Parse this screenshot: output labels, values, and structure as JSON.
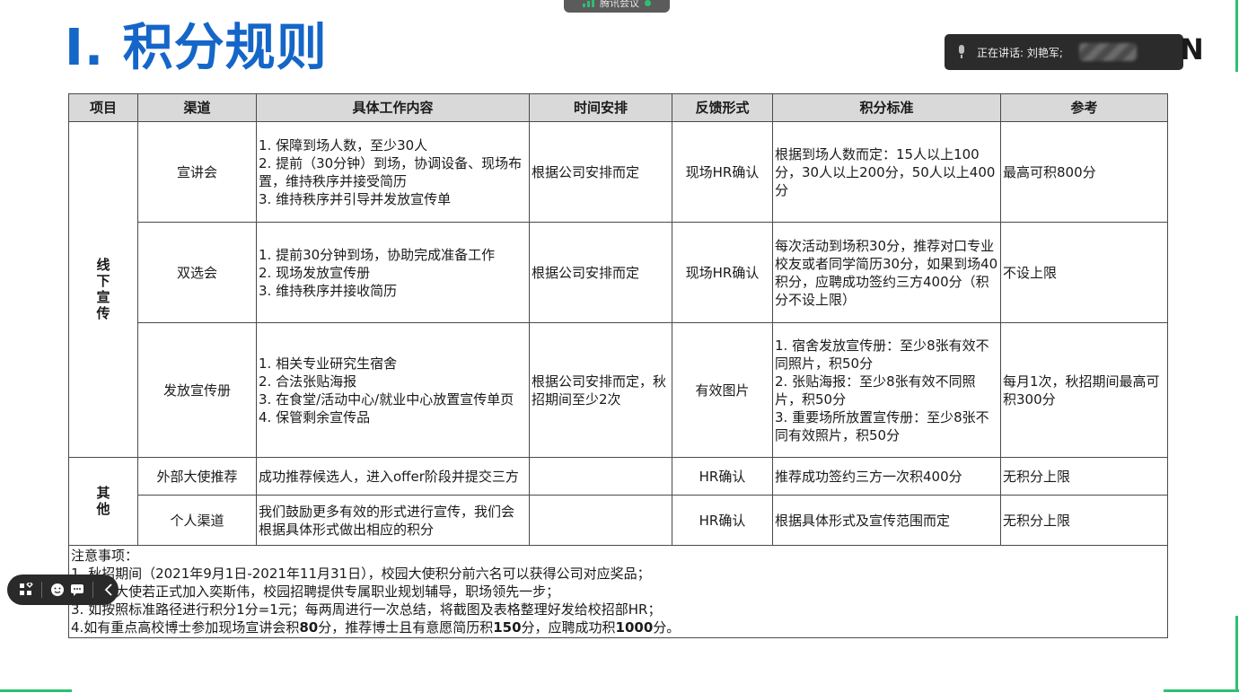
{
  "meeting_app": {
    "title": "腾讯会议"
  },
  "slide": {
    "title": "I. 积分规则",
    "corner_letter": "N"
  },
  "speaking": {
    "label": "正在讲话: 刘艳军;"
  },
  "table": {
    "headers": [
      "项目",
      "渠道",
      "具体工作内容",
      "时间安排",
      "反馈形式",
      "积分标准",
      "参考"
    ],
    "groups": [
      {
        "name": "线下宣传",
        "rows": [
          {
            "channel": "宣讲会",
            "content": [
              "1. 保障到场人数，至少30人",
              "2. 提前（30分钟）到场，协调设备、现场布置，维持秩序并接受简历",
              "3. 维持秩序并引导并发放宣传单"
            ],
            "schedule": "根据公司安排而定",
            "feedback": "现场HR确认",
            "points": "根据到场人数而定：15人以上100分，30人以上200分，50人以上400分",
            "reference": "最高可积800分"
          },
          {
            "channel": "双选会",
            "content": [
              "1. 提前30分钟到场，协助完成准备工作",
              "2. 现场发放宣传册",
              "3. 维持秩序并接收简历"
            ],
            "schedule": "根据公司安排而定",
            "feedback": "现场HR确认",
            "points": "每次活动到场积30分，推荐对口专业校友或者同学简历30分，如果到场40积分，应聘成功签约三方400分（积分不设上限）",
            "reference": "不设上限"
          },
          {
            "channel": "发放宣传册",
            "content": [
              "1. 相关专业研究生宿舍",
              "2. 合法张贴海报",
              "3. 在食堂/活动中心/就业中心放置宣传单页",
              "4. 保管剩余宣传品"
            ],
            "schedule": "根据公司安排而定，秋招期间至少2次",
            "feedback": "有效图片",
            "points": [
              "1. 宿舍发放宣传册：至少8张有效不同照片，积50分",
              "2. 张贴海报：至少8张有效不同照片，积50分",
              "3. 重要场所放置宣传册：至少8张不同有效照片，积50分"
            ],
            "reference": "每月1次，秋招期间最高可积300分"
          }
        ]
      },
      {
        "name": "其他",
        "rows": [
          {
            "channel": "外部大使推荐",
            "content": [
              "成功推荐候选人，进入offer阶段并提交三方"
            ],
            "schedule": "",
            "feedback": "HR确认",
            "points": "推荐成功签约三方一次积400分",
            "reference": "无积分上限"
          },
          {
            "channel": "个人渠道",
            "content": [
              "我们鼓励更多有效的形式进行宣传，我们会根据具体形式做出相应的积分"
            ],
            "schedule": "",
            "feedback": "HR确认",
            "points": "根据具体形式及宣传范围而定",
            "reference": "无积分上限"
          }
        ]
      }
    ],
    "notes": {
      "heading": "注意事项：",
      "n1": "1. 秋招期间（2021年9月1日-2021年11月31日），校园大使积分前六名可以获得公司对应奖品；",
      "n2": "2. 校园大使若正式加入奕斯伟，校园招聘提供专属职业规划辅导，职场领先一步；",
      "n3": "3. 如按照标准路径进行积分1分=1元；每两周进行一次总结，将截图及表格整理好发给校招部HR；",
      "n4_a": "4.如有重点高校博士参加现场宣讲会积",
      "n4_b": "80",
      "n4_c": "分，推荐博士且有意愿简历积",
      "n4_d": "150",
      "n4_e": "分，应聘成功积",
      "n4_f": "1000",
      "n4_g": "分。"
    }
  },
  "colors": {
    "title_blue": "#1466c8",
    "accent_green": "#2fbf71",
    "header_gray": "#d9d9d9"
  }
}
